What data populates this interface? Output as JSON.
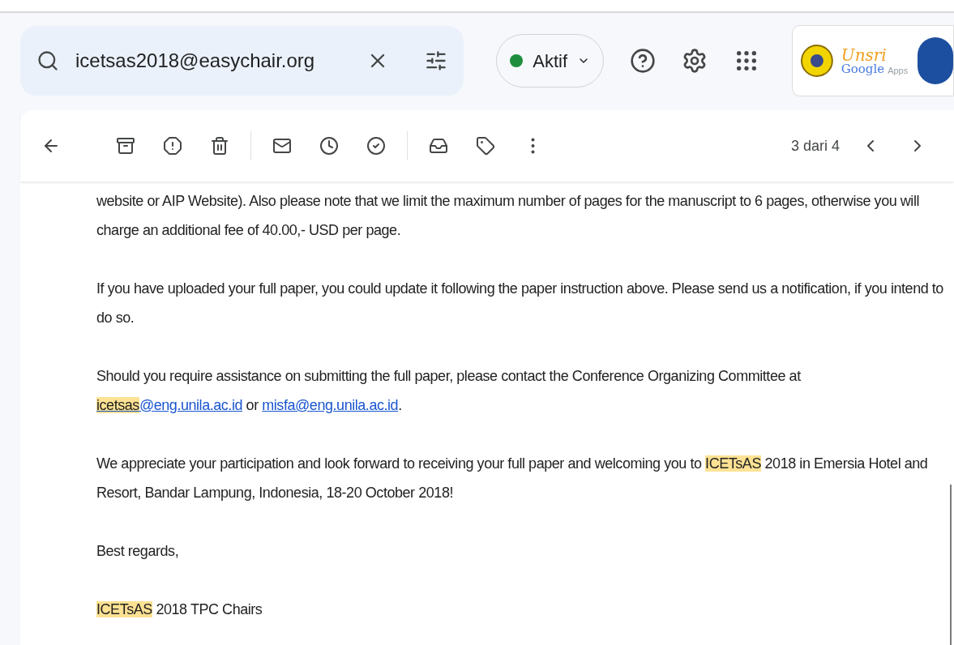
{
  "search": {
    "value": "icetsas2018@easychair.org"
  },
  "status": {
    "label": "Aktif",
    "active": true
  },
  "logo": {
    "words": [
      "Unsri",
      "Google",
      "Apps"
    ]
  },
  "toolbar": {
    "pager": "3 dari 4"
  },
  "paragraphs": [
    [
      {
        "kind": "text",
        "text": "website or AIP Website). Also please note that we limit the maximum number of pages for the manuscript to 6 pages, otherwise you will charge an additional fee of 40.00,- USD per page."
      }
    ],
    [
      {
        "kind": "text",
        "text": "If you have uploaded your full paper, you could update it following the paper instruction above. Please send us a notification, if you intend to do so."
      }
    ],
    [
      {
        "kind": "text",
        "text": "Should you require assistance on submitting the full paper, please contact the Conference Organizing Committee at "
      },
      {
        "kind": "link",
        "parts": [
          {
            "text": "icetsas",
            "highlight": true
          },
          {
            "text": "@eng.unila.ac.id",
            "highlight": false
          }
        ]
      },
      {
        "kind": "text",
        "text": " or "
      },
      {
        "kind": "link",
        "parts": [
          {
            "text": "misfa@eng.unila.ac.id",
            "highlight": false
          }
        ]
      },
      {
        "kind": "text",
        "text": "."
      }
    ],
    [
      {
        "kind": "text",
        "text": "We appreciate your participation and look forward to receiving your full paper and welcoming you to "
      },
      {
        "kind": "highlight",
        "text": "ICETsAS"
      },
      {
        "kind": "text",
        "text": " 2018 in Emersia Hotel and Resort, Bandar Lampung, Indonesia, 18-20 October 2018!"
      }
    ],
    [
      {
        "kind": "text",
        "text": "Best regards,"
      }
    ],
    [
      {
        "kind": "highlight",
        "text": "ICETsAS"
      },
      {
        "kind": "text",
        "text": " 2018 TPC Chairs"
      }
    ]
  ]
}
